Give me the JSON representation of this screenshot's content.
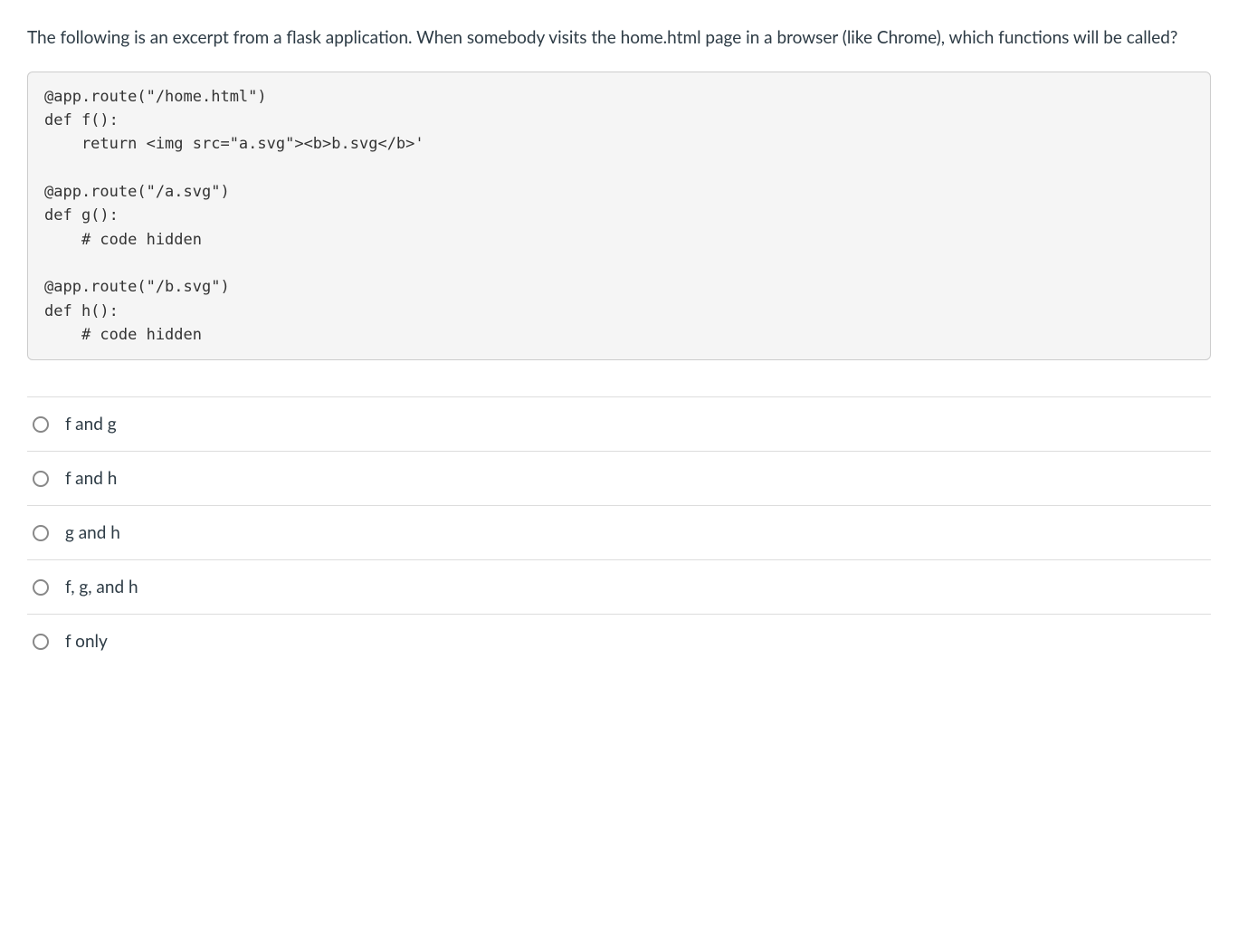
{
  "question": "The following is an excerpt from a flask application. When somebody visits the home.html page in a browser (like Chrome), which functions will be called?",
  "code": "@app.route(\"/home.html\")\ndef f():\n    return <img src=\"a.svg\"><b>b.svg</b>'\n\n@app.route(\"/a.svg\")\ndef g():\n    # code hidden\n\n@app.route(\"/b.svg\")\ndef h():\n    # code hidden",
  "options": [
    {
      "label": "f and g"
    },
    {
      "label": "f and h"
    },
    {
      "label": "g and h"
    },
    {
      "label": "f, g, and h"
    },
    {
      "label": "f only"
    }
  ]
}
